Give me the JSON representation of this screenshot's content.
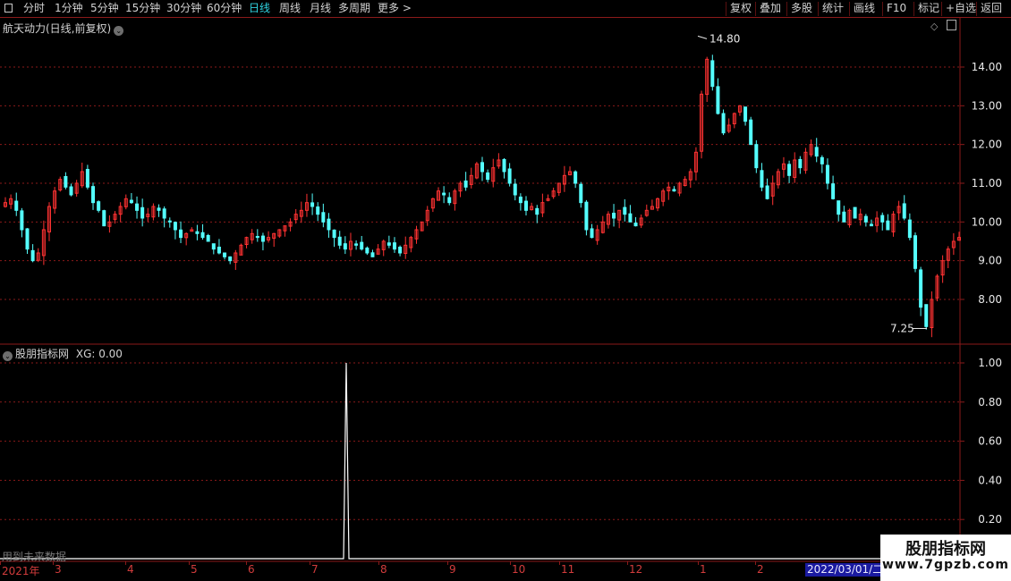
{
  "toolbar": {
    "left_items": [
      "分时",
      "1分钟",
      "5分钟",
      "15分钟",
      "30分钟",
      "60分钟",
      "日线",
      "周线",
      "月线",
      "多周期",
      "更多 >"
    ],
    "active": "日线",
    "right_items": [
      "复权",
      "叠加",
      "多股",
      "统计",
      "画线",
      "F10",
      "标记",
      "+自选",
      "返回"
    ]
  },
  "main_panel": {
    "title": "航天动力(日线,前复权)",
    "high_label": "14.80",
    "low_label": "7.25",
    "axis_ticks": [
      "14.00",
      "13.00",
      "12.00",
      "11.00",
      "10.00",
      "9.00",
      "8.00"
    ]
  },
  "indicator_panel": {
    "title": "股朋指标网",
    "value_text": "XG: 0.00",
    "axis_ticks": [
      "1.00",
      "0.80",
      "0.60",
      "0.40",
      "0.20"
    ],
    "note": "用到未来数据"
  },
  "time_axis": {
    "labels": [
      "2021年",
      "3",
      "4",
      "5",
      "6",
      "7",
      "8",
      "9",
      "10",
      "11",
      "12",
      "1",
      "2"
    ],
    "cursor_date": "2022/03/01/二"
  },
  "watermark": {
    "title": "股朋指标网",
    "url": "www.7gpzb.com"
  },
  "colors": {
    "up": "#ff3232",
    "down": "#54ffff",
    "grid": "#8b1a1a",
    "active_tab": "#2fd3e0"
  },
  "chart_data": [
    {
      "type": "candlestick",
      "title": "航天动力(日线,前复权)",
      "period": "2021-01 to 2022-03",
      "ylim": [
        7.0,
        15.0
      ],
      "y_ticks": [
        8,
        9,
        10,
        11,
        12,
        13,
        14
      ],
      "annotations": [
        {
          "text": "14.80",
          "type": "high"
        },
        {
          "text": "7.25",
          "type": "low"
        }
      ],
      "closes": [
        10.5,
        10.6,
        10.3,
        9.8,
        9.3,
        9.0,
        9.2,
        9.8,
        10.4,
        10.8,
        11.1,
        10.9,
        10.7,
        11.0,
        11.3,
        10.9,
        10.5,
        10.3,
        9.9,
        10.0,
        10.2,
        10.4,
        10.6,
        10.5,
        10.3,
        10.1,
        10.2,
        10.4,
        10.3,
        10.1,
        10.0,
        9.8,
        9.6,
        9.7,
        9.8,
        9.7,
        9.6,
        9.5,
        9.3,
        9.2,
        9.1,
        9.0,
        9.2,
        9.4,
        9.6,
        9.7,
        9.6,
        9.5,
        9.6,
        9.7,
        9.8,
        9.9,
        10.0,
        10.2,
        10.3,
        10.5,
        10.4,
        10.2,
        10.0,
        9.8,
        9.6,
        9.4,
        9.3,
        9.5,
        9.4,
        9.3,
        9.2,
        9.1,
        9.3,
        9.5,
        9.4,
        9.3,
        9.2,
        9.4,
        9.6,
        9.8,
        10.0,
        10.3,
        10.6,
        10.8,
        10.7,
        10.5,
        10.8,
        11.0,
        10.9,
        11.2,
        11.5,
        11.3,
        11.1,
        11.4,
        11.6,
        11.3,
        11.0,
        10.7,
        10.5,
        10.3,
        10.4,
        10.2,
        10.5,
        10.6,
        10.8,
        11.0,
        11.2,
        11.3,
        11.0,
        10.5,
        9.8,
        9.6,
        9.8,
        10.0,
        10.2,
        10.1,
        10.3,
        10.2,
        10.0,
        9.9,
        10.1,
        10.3,
        10.4,
        10.6,
        10.8,
        10.9,
        10.8,
        11.0,
        11.1,
        11.3,
        11.8,
        13.3,
        14.2,
        13.5,
        12.8,
        12.3,
        12.5,
        12.8,
        13.0,
        12.6,
        12.0,
        11.4,
        10.9,
        10.6,
        11.0,
        11.3,
        11.5,
        11.2,
        11.6,
        11.4,
        11.8,
        12.0,
        11.7,
        11.5,
        11.0,
        10.6,
        10.2,
        10.0,
        10.3,
        10.1,
        10.2,
        10.0,
        9.9,
        10.1,
        10.0,
        9.8,
        10.2,
        10.4,
        10.1,
        9.6,
        8.8,
        7.8,
        7.3,
        8.0,
        8.6,
        9.0,
        9.3,
        9.5,
        9.6
      ]
    },
    {
      "type": "line",
      "title": "股朋指标网",
      "series": [
        {
          "name": "XG",
          "values": "0 on all bars except a single spike to 1.00 in late July 2021"
        }
      ],
      "ylim": [
        0,
        1.05
      ],
      "y_ticks": [
        0.2,
        0.4,
        0.6,
        0.8,
        1.0
      ],
      "spike_value": 1.0,
      "current_value": 0.0
    }
  ]
}
